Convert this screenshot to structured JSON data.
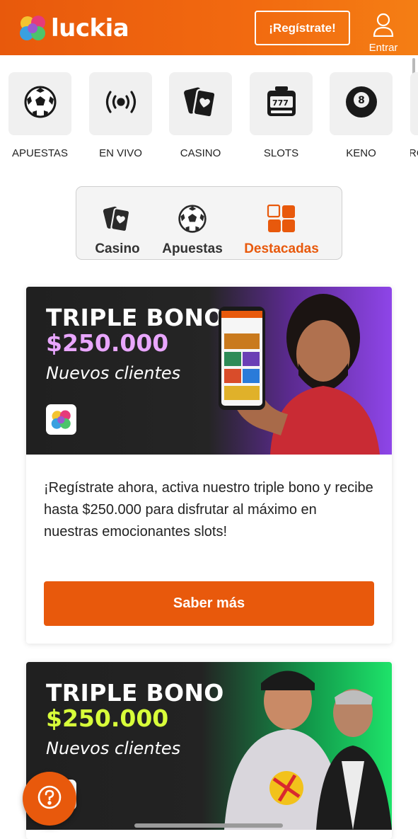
{
  "header": {
    "brand": "luckia",
    "register_label": "¡Regístrate!",
    "login_label": "Entrar",
    "colors": {
      "bar": "#e8590c",
      "text": "#ffffff"
    }
  },
  "categories": [
    {
      "label": "APUESTAS",
      "icon": "soccer-ball-icon"
    },
    {
      "label": "EN VIVO",
      "icon": "live-broadcast-icon"
    },
    {
      "label": "CASINO",
      "icon": "playing-cards-icon"
    },
    {
      "label": "SLOTS",
      "icon": "slot-machine-icon"
    },
    {
      "label": "KENO",
      "icon": "eight-ball-icon"
    },
    {
      "label": "PRO",
      "icon": "promotions-icon"
    }
  ],
  "tabs": [
    {
      "label": "Casino",
      "icon": "playing-cards-icon",
      "active": false
    },
    {
      "label": "Apuestas",
      "icon": "soccer-ball-icon",
      "active": false
    },
    {
      "label": "Destacadas",
      "icon": "grid-icon",
      "active": true
    }
  ],
  "promos": [
    {
      "title": "TRIPLE BONO",
      "amount": "$250.000",
      "subtitle": "Nuevos clientes",
      "amount_color": "#e9a6ff",
      "description": "¡Regístrate ahora, activa nuestro triple bono y recibe hasta $250.000 para disfrutar al máximo en nuestras emocionantes slots!",
      "cta_label": "Saber más"
    },
    {
      "title": "TRIPLE BONO",
      "amount": "$250.000",
      "subtitle": "Nuevos clientes",
      "amount_color": "#d8ff3a"
    }
  ],
  "accent": "#e8590c"
}
